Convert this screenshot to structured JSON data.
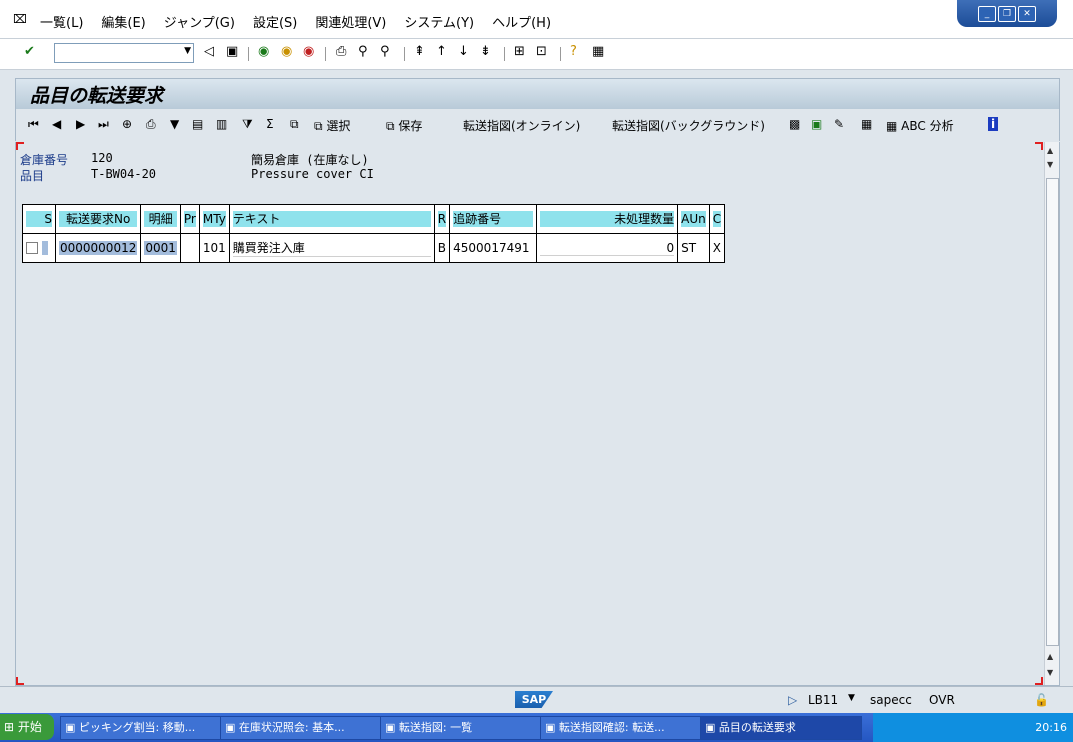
{
  "menubar": {
    "items": [
      "一覧(L)",
      "編集(E)",
      "ジャンプ(G)",
      "設定(S)",
      "関連処理(V)",
      "システム(Y)",
      "ヘルプ(H)"
    ]
  },
  "toolbar": {
    "command_value": ""
  },
  "title": "品目の転送要求",
  "app_toolbar": {
    "select_label": "選択",
    "save_label": "保存",
    "to_online_label": "転送指図(オンライン)",
    "to_background_label": "転送指図(バックグラウンド)",
    "abc_label": "ABC 分析"
  },
  "header": {
    "warehouse_label": "倉庫番号",
    "warehouse_value": "120",
    "warehouse_desc": "簡易倉庫 (在庫なし)",
    "material_label": "品目",
    "material_value": "T-BW04-20",
    "material_desc": "Pressure cover CI"
  },
  "table": {
    "columns": [
      "S",
      "転送要求No",
      "明細",
      "Pr",
      "MTy",
      "テキスト",
      "R",
      "追跡番号",
      "未処理数量",
      "AUn",
      "C"
    ],
    "rows": [
      {
        "tr_no": "0000000012",
        "item": "0001",
        "pr": "",
        "mty": "101",
        "text": "購買発注入庫",
        "r": "B",
        "tracking": "4500017491",
        "open_qty": "0",
        "aun": "ST",
        "c": "X"
      }
    ]
  },
  "status": {
    "server": "LB11",
    "client": "sapecc",
    "mode": "OVR",
    "sap_logo": "SAP"
  },
  "taskbar": {
    "start_label": "开始",
    "tasks": [
      "ピッキング割当: 移動...",
      "在庫状況照会: 基本...",
      "転送指図: 一覧",
      "転送指図確認: 転送...",
      "品目の転送要求"
    ],
    "clock": "20:16"
  },
  "colors": {
    "header_cell": "#8fe2ec",
    "selection": "#a3bcdc",
    "taskbar": "#2456c2"
  }
}
